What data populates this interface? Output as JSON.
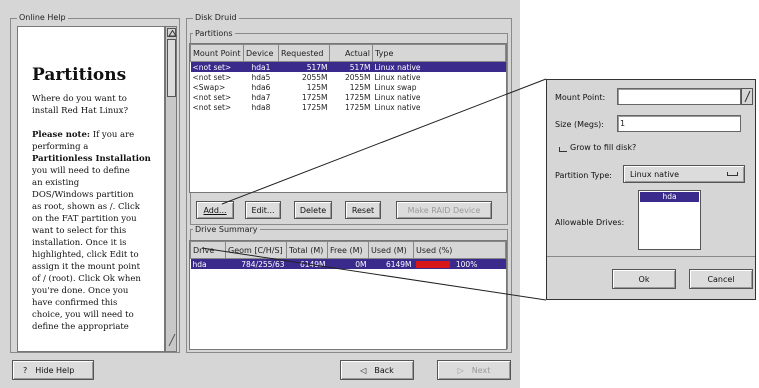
{
  "help": {
    "group_label": "Online Help",
    "heading": "Partitions",
    "intro": "Where do you want to install Red Hat Linux?",
    "note_bold": "Please note:",
    "note_bold2": "Partitionless Installation",
    "note_lines": [
      "If you are",
      "performing a",
      "you will need to define",
      "an existing",
      "DOS/Windows partition",
      "as root, shown as /. Click",
      "on the FAT partition you",
      "want to select for this",
      "installation. Once it is",
      "highlighted, click Edit to",
      "assign it the mount point",
      "of / (root). Click Ok when",
      "you're done. Once you",
      "have confirmed this",
      "choice, you will need to",
      "define the appropriate"
    ]
  },
  "druid": {
    "group_label": "Disk Druid",
    "partitions_label": "Partitions",
    "columns": [
      "Mount Point",
      "Device",
      "Requested",
      "Actual",
      "Type"
    ],
    "rows": [
      [
        "<not set>",
        "hda1",
        "517M",
        "517M",
        "Linux native"
      ],
      [
        "<not set>",
        "hda5",
        "2055M",
        "2055M",
        "Linux native"
      ],
      [
        "<Swap>",
        "hda6",
        "125M",
        "125M",
        "Linux swap"
      ],
      [
        "<not set>",
        "hda7",
        "1725M",
        "1725M",
        "Linux native"
      ],
      [
        "<not set>",
        "hda8",
        "1725M",
        "1725M",
        "Linux native"
      ]
    ],
    "buttons": {
      "add": "Add...",
      "edit": "Edit...",
      "delete": "Delete",
      "reset": "Reset",
      "raid": "Make RAID Device"
    },
    "summary_label": "Drive Summary",
    "summary_columns": [
      "Drive",
      "Geom [C/H/S]",
      "Total (M)",
      "Free (M)",
      "Used (M)",
      "Used (%)"
    ],
    "summary_row": [
      "hda",
      "784/255/63",
      "6149M",
      "0M",
      "6149M",
      "100%"
    ]
  },
  "nav": {
    "hide_help": "Hide Help",
    "back": "Back",
    "next": "Next"
  },
  "dialog": {
    "mount_point_label": "Mount Point:",
    "mount_point_value": "",
    "size_label": "Size (Megs):",
    "size_value": "1",
    "grow_label": "Grow to fill disk?",
    "ptype_label": "Partition Type:",
    "ptype_value": "Linux native",
    "drives_label": "Allowable Drives:",
    "drive_item": "hda",
    "ok": "Ok",
    "cancel": "Cancel"
  },
  "colors": {
    "selection": "#3a2a8c",
    "usage_bar": "#d81818"
  }
}
